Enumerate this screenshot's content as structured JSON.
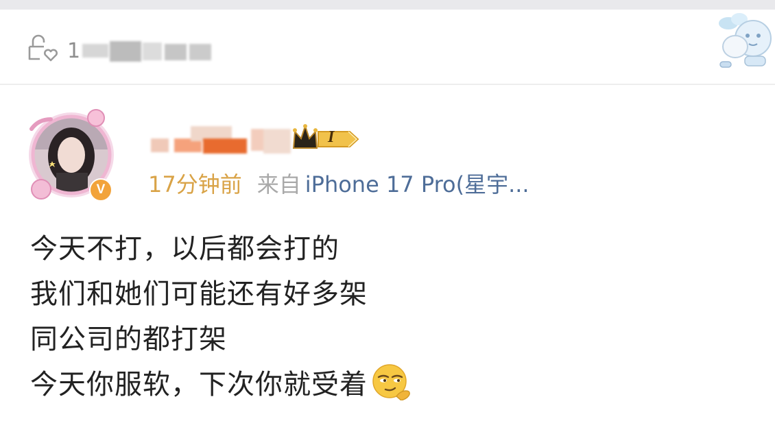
{
  "top_bar": {
    "like_count": "1"
  },
  "post": {
    "time": "17分钟前",
    "source_prefix": "来自",
    "device": "iPhone 17 Pro(星宇...",
    "level_badge": "I",
    "verified_mark": "V",
    "lines": [
      "今天不打，以后都会打的",
      "我们和她们可能还有好多架",
      "同公司的都打架",
      "今天你服软，下次你就受着"
    ],
    "trailing_emoji": "smirk-emoji"
  },
  "colors": {
    "time": "#d9a347",
    "source": "#a9a9a9",
    "device": "#4e6d98",
    "text": "#222222",
    "muted": "#8e8e8e"
  }
}
